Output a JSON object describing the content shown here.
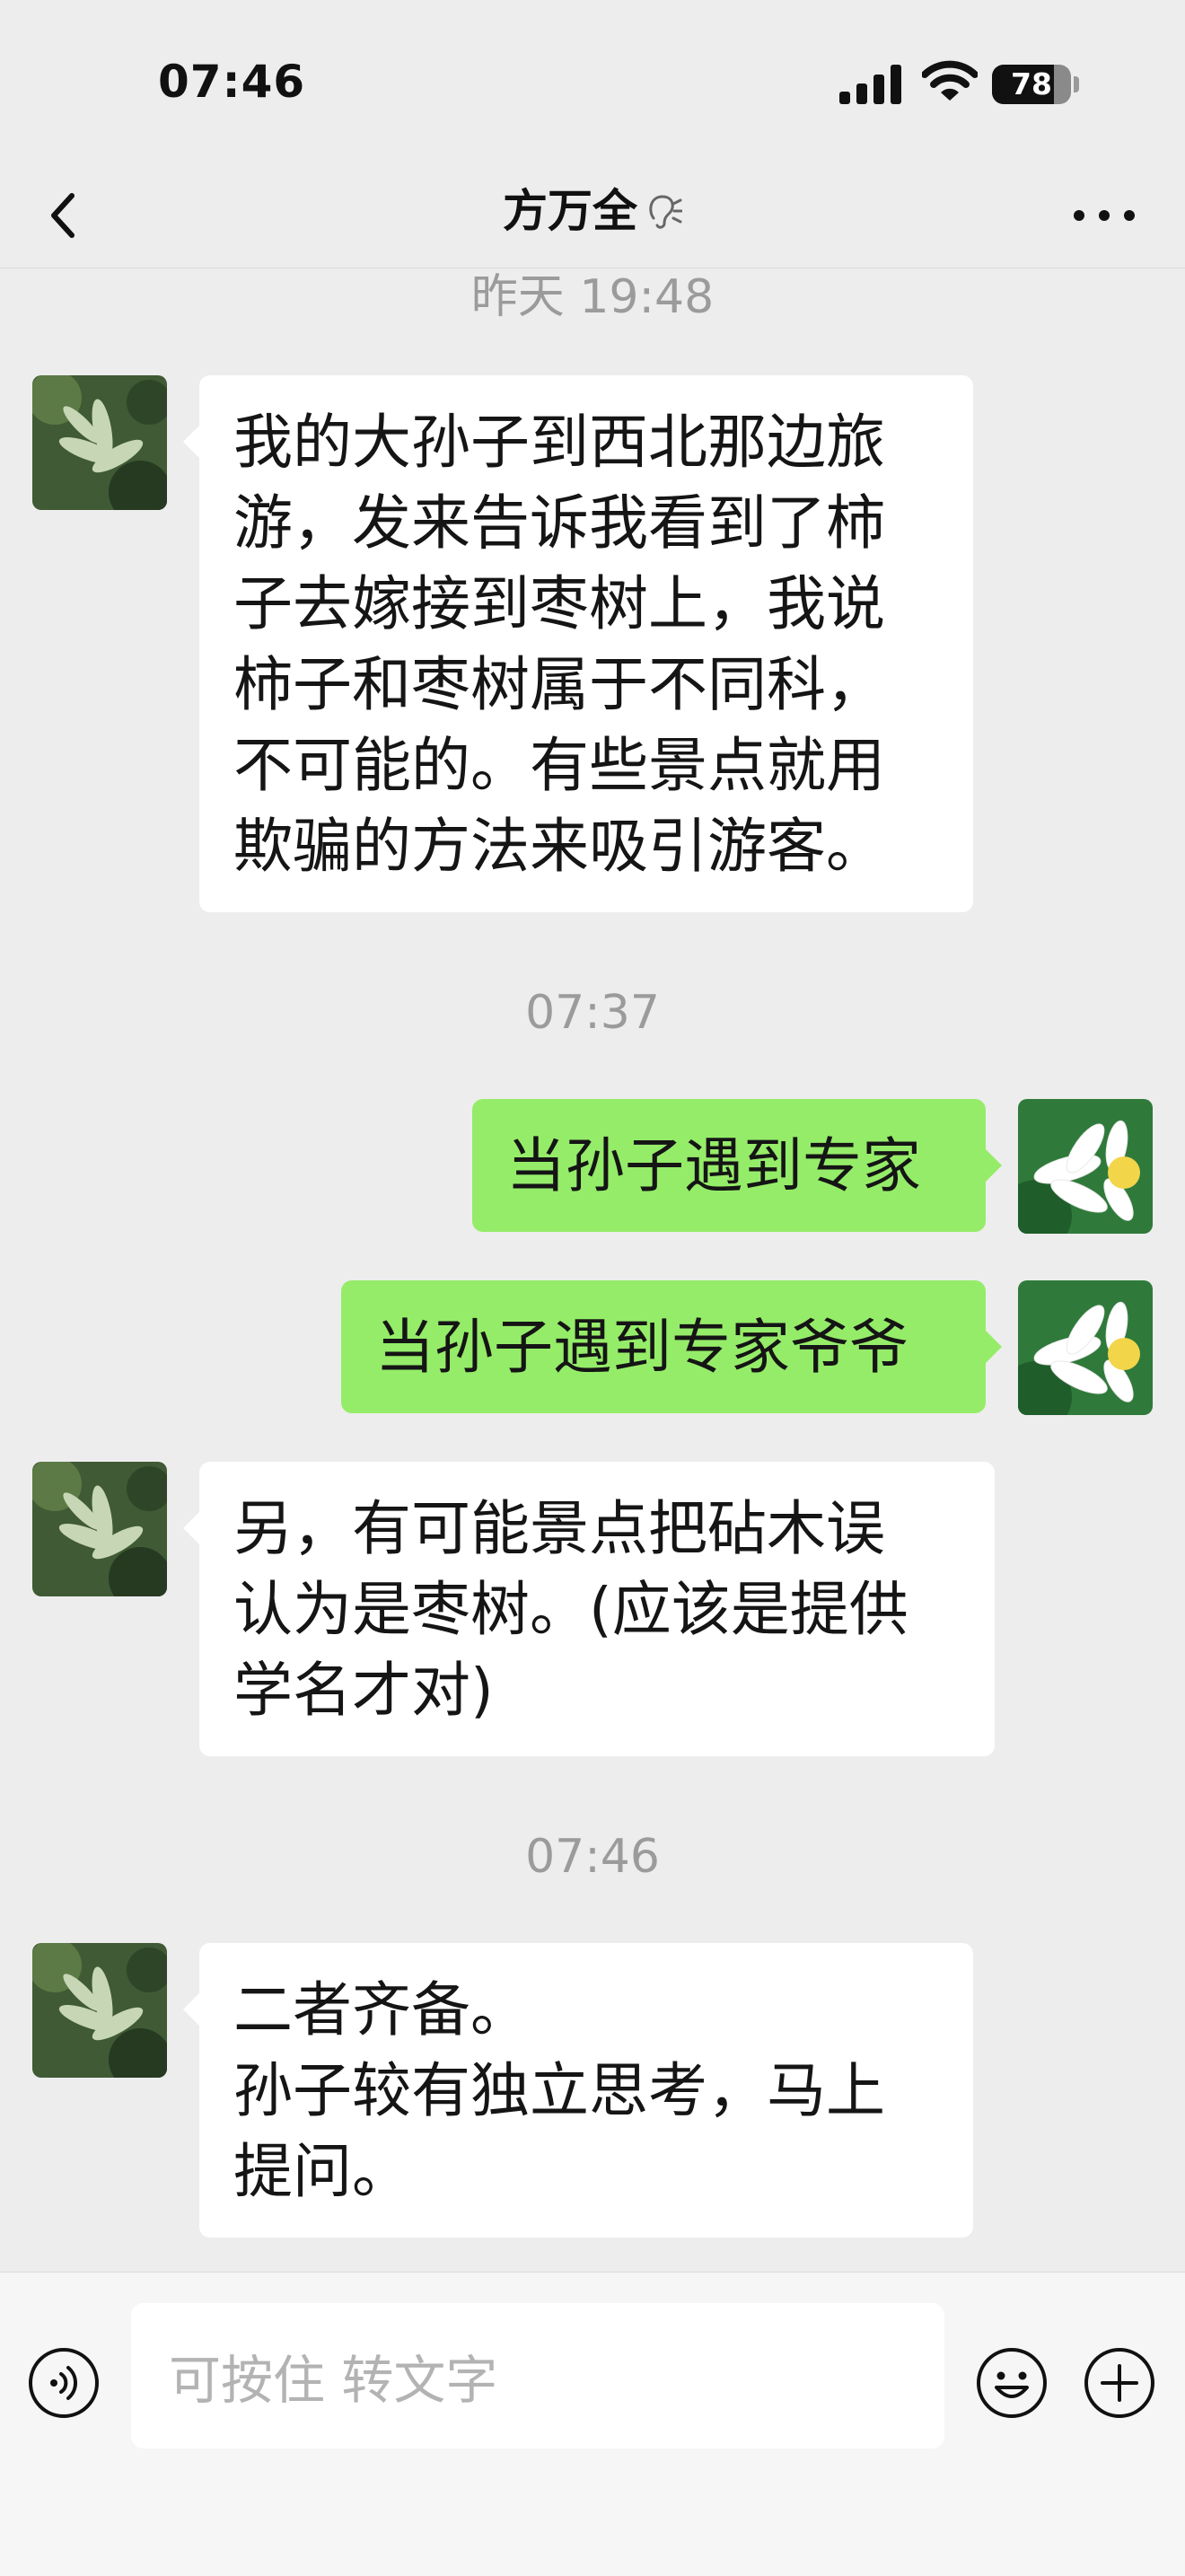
{
  "status_bar": {
    "time": "07:46",
    "battery": "78",
    "battery_fraction": 0.78,
    "signal_icon": "cellular-signal-icon",
    "wifi_icon": "wifi-icon"
  },
  "nav": {
    "title": "方万全",
    "back_icon": "chevron-left-icon",
    "mute_icon": "ear-icon",
    "more_icon": "more-dots-icon"
  },
  "messages": {
    "t1": "昨天 19:48",
    "m1": "我的大孙子到西北那边旅\n游，发来告诉我看到了柿\n子去嫁接到枣树上，我说\n柿子和枣树属于不同科，\n不可能的。有些景点就用\n欺骗的方法来吸引游客。",
    "t2": "07:37",
    "m2": "当孙子遇到专家",
    "m3": "当孙子遇到专家爷爷",
    "m4": "另，有可能景点把砧木误\n认为是枣树。(应该是提供\n学名才对)",
    "t3": "07:46",
    "m5": "二者齐备。\n孙子较有独立思考，马上\n提问。"
  },
  "input_bar": {
    "placeholder": "可按住 转文字",
    "voice_icon": "voice-icon",
    "emoji_icon": "emoji-icon",
    "add_icon": "plus-icon"
  },
  "colors": {
    "sent_bubble": "#95ec69",
    "received_bubble": "#ffffff",
    "background": "#ededed"
  }
}
